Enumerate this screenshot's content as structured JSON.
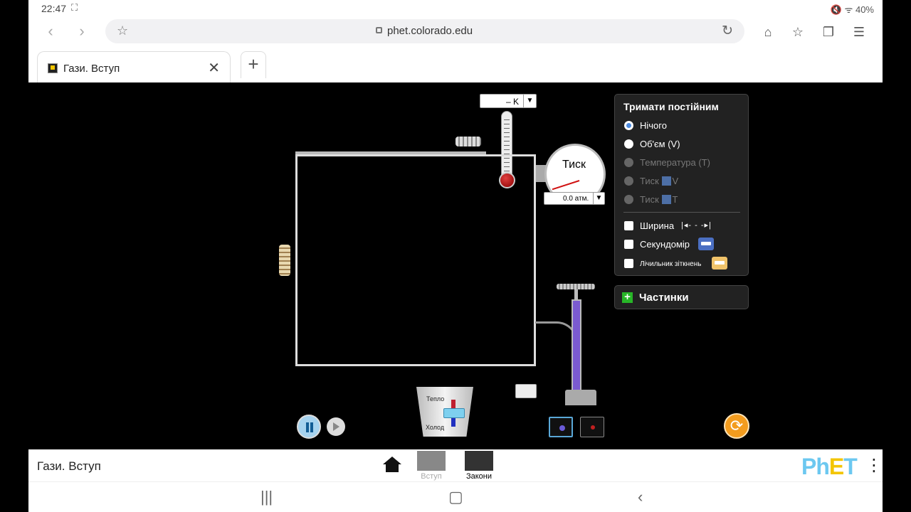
{
  "status_bar": {
    "time": "22:47",
    "battery": "40%"
  },
  "browser": {
    "url": "phet.colorado.edu",
    "tab_title": "Гази. Вступ"
  },
  "panel": {
    "title": "Тримати постійним",
    "options": [
      {
        "label": "Нічого",
        "selected": true,
        "enabled": true
      },
      {
        "label": "Об'єм (V)",
        "selected": false,
        "enabled": true
      },
      {
        "label": "Температура (T)",
        "selected": false,
        "enabled": false
      },
      {
        "label_prefix": "Тиск ",
        "label_suffix": "V",
        "selected": false,
        "enabled": false
      },
      {
        "label_prefix": "Тиск ",
        "label_suffix": "T",
        "selected": false,
        "enabled": false
      }
    ],
    "checkboxes": {
      "width": "Ширина",
      "stopwatch": "Секундомір",
      "collisions": "Лічильник зіткнень"
    }
  },
  "particles_label": "Частинки",
  "thermometer": {
    "readout": "– K"
  },
  "gauge": {
    "label": "Тиск",
    "readout": "0.0 атм."
  },
  "bucket": {
    "hot": "Тепло",
    "cold": "Холод"
  },
  "phet_bar": {
    "title": "Гази. Вступ",
    "screens": [
      {
        "label": "Вступ",
        "active": false
      },
      {
        "label": "Закони",
        "active": true
      }
    ],
    "logo": "PhET"
  },
  "colors": {
    "heavy_particle": "#6a5bd8",
    "light_particle": "#c02020",
    "reset": "#f39c1e"
  }
}
